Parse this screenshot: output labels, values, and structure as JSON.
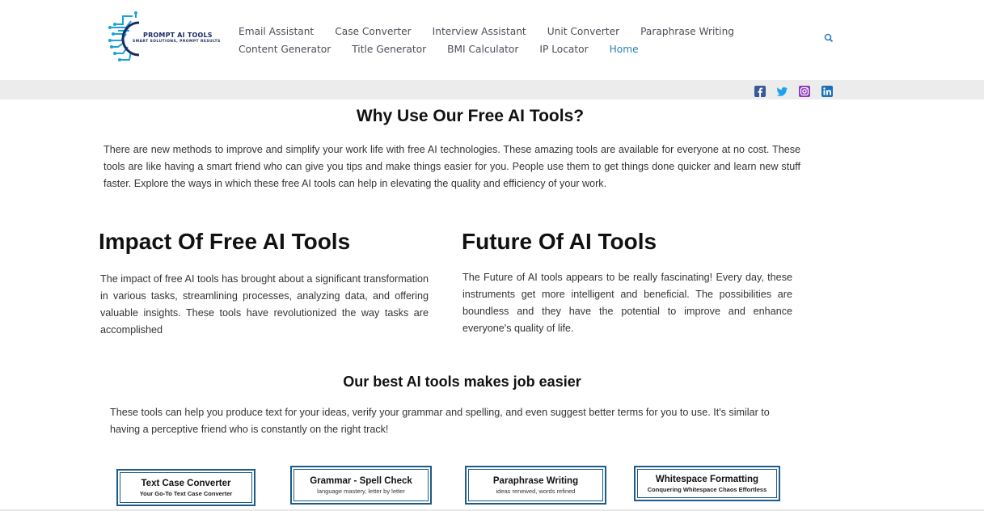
{
  "header": {
    "logo": {
      "title": "PROMPT AI TOOLS",
      "tagline": "SMART SOLUTIONS, PROMPT RESULTS"
    },
    "nav_row1": [
      "Email Assistant",
      "Case Converter",
      "Interview Assistant",
      "Unit Converter",
      "Paraphrase Writing"
    ],
    "nav_row2": [
      "Content Generator",
      "Title Generator",
      "BMI Calculator",
      "IP Locator",
      "Home"
    ],
    "active_item": "Home",
    "search_icon": "search-icon"
  },
  "social": {
    "icons": [
      "facebook-icon",
      "twitter-icon",
      "instagram-icon",
      "linkedin-icon"
    ]
  },
  "sections": {
    "why": {
      "title": "Why Use Our Free AI Tools?",
      "text": "There are new methods to improve and simplify your work life with free AI technologies. These amazing tools are available for everyone at no cost. These tools are like having a smart friend who can give you tips and make things easier for you. People use them to get things done quicker and learn new stuff faster. Explore the ways in which these free AI tools can help in elevating the quality and efficiency of your work."
    },
    "impact": {
      "title": "Impact Of Free AI Tools",
      "text": "The impact of free AI tools has brought about a significant transformation in various tasks, streamlining processes, analyzing data, and offering valuable insights. These tools have revolutionized the way tasks are accomplished"
    },
    "future": {
      "title": "Future Of AI Tools",
      "text": "The Future of AI tools appears to be really fascinating! Every day, these instruments get more intelligent and beneficial. The possibilities are boundless and they have the potential to improve and enhance everyone's quality of life."
    },
    "best": {
      "title": "Our best AI tools makes job easier",
      "text": "These tools can help you produce text for your ideas, verify your grammar and spelling, and even suggest better terms for you to use. It's similar to having a perceptive friend who is constantly on the right track!"
    }
  },
  "cards": [
    {
      "title": "Text Case Converter",
      "subtitle": "Your Go-To Text Case Converter"
    },
    {
      "title": "Grammar - Spell Check",
      "subtitle": "language mastery, letter by letter"
    },
    {
      "title": "Paraphrase Writing",
      "subtitle": "ideas renewed, words refined"
    },
    {
      "title": "Whitespace Formatting",
      "subtitle": "Conquering Whitespace Chaos Effortless"
    }
  ],
  "colors": {
    "accent": "#2c7fb8",
    "nav_text": "#4b4f58",
    "card_border": "#1e5a8a",
    "facebook": "#3b5998",
    "twitter": "#1da1f2",
    "instagram": "#8a3ab9",
    "linkedin": "#1b6fb5"
  }
}
